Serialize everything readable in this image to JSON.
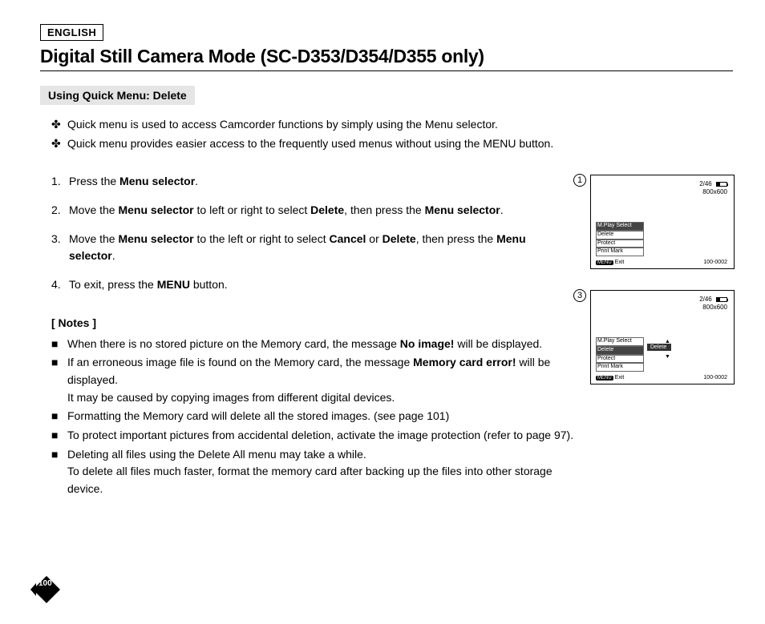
{
  "lang": "ENGLISH",
  "title": "Digital Still Camera Mode  (SC-D353/D354/D355 only)",
  "subheading": "Using Quick Menu: Delete",
  "features": [
    "Quick menu is used to access Camcorder functions by simply using the Menu selector.",
    "Quick menu provides easier access to the frequently used menus without using the MENU button."
  ],
  "steps": [
    {
      "n": "1.",
      "plain_a": "Press the ",
      "b1": "Menu selector",
      "plain_b": "."
    },
    {
      "n": "2.",
      "plain_a": "Move the ",
      "b1": "Menu selector",
      "plain_b": " to left or right to select ",
      "b2": "Delete",
      "plain_c": ", then press the ",
      "b3": "Menu selector",
      "plain_d": "."
    },
    {
      "n": "3.",
      "plain_a": "Move the ",
      "b1": "Menu selector",
      "plain_b": " to the left or right to select ",
      "b2": "Cancel",
      "plain_c": " or ",
      "b3": "Delete",
      "plain_d": ", then press the ",
      "b4": "Menu selector",
      "plain_e": "."
    },
    {
      "n": "4.",
      "plain_a": "To exit, press the ",
      "b1": "MENU",
      "plain_b": " button."
    }
  ],
  "notes_heading": "[ Notes ]",
  "notes": [
    {
      "a": "When there is no stored picture on the Memory card, the message ",
      "b1": "No image!",
      "c": " will be displayed."
    },
    {
      "a": "If an erroneous image file is found on the Memory card, the message ",
      "b1": "Memory card error!",
      "c": " will be displayed.\nIt may be caused by copying images from different digital devices."
    },
    {
      "a": "Formatting the Memory card will delete all the stored images. (see page 101)"
    },
    {
      "a": "To protect important pictures from accidental deletion, activate the image protection (refer to page 97)."
    },
    {
      "a": "Deleting all files using the Delete All menu may take a while.\nTo delete all files much faster, format the memory card after backing up the files into other storage device."
    }
  ],
  "figs": {
    "fig1": {
      "badge": "1",
      "counter": "2/46",
      "res": "800x600",
      "menu": [
        "M.Play Select",
        "Delete",
        "Protect",
        "Print Mark"
      ],
      "sel_index": 0,
      "menu_btn": "MENU",
      "exit": "Exit",
      "id": "100-0002"
    },
    "fig3": {
      "badge": "3",
      "counter": "2/46",
      "res": "800x600",
      "menu": [
        "M.Play Select",
        "Delete",
        "Protect",
        "Print Mark"
      ],
      "sel_index": 1,
      "submenu": "Delete",
      "menu_btn": "MENU",
      "exit": "Exit",
      "id": "100-0002"
    }
  },
  "page_number": "100"
}
